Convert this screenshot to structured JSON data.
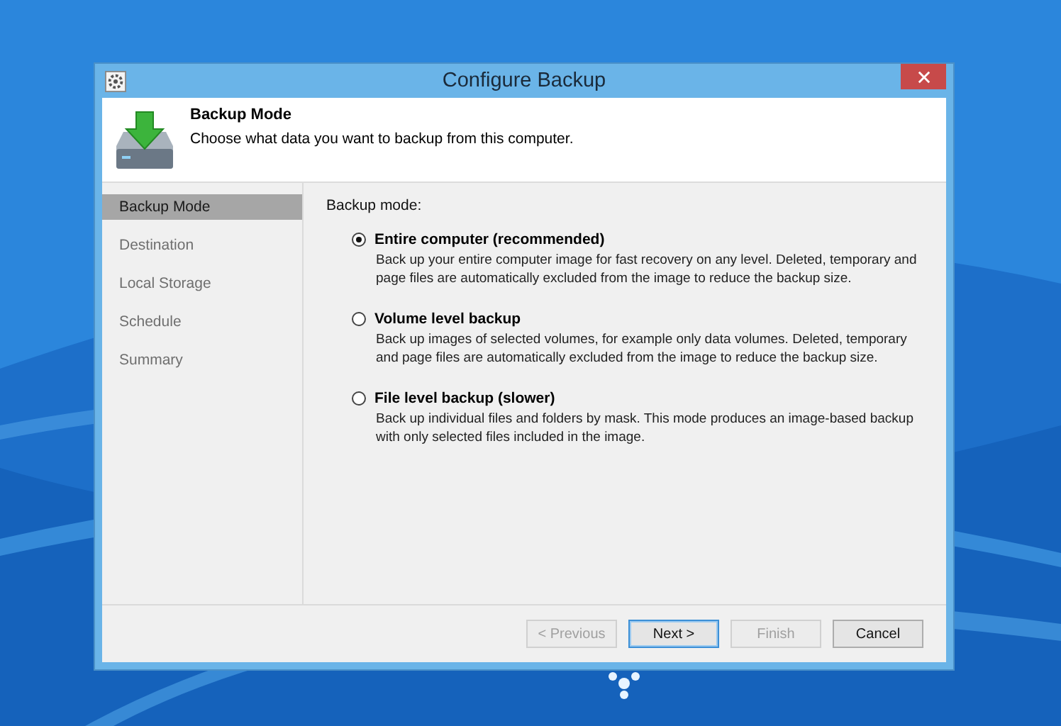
{
  "window": {
    "title": "Configure Backup"
  },
  "header": {
    "title": "Backup Mode",
    "subtitle": "Choose what data you want to backup from this computer."
  },
  "sidebar": {
    "items": [
      {
        "label": "Backup Mode",
        "selected": true
      },
      {
        "label": "Destination",
        "selected": false
      },
      {
        "label": "Local Storage",
        "selected": false
      },
      {
        "label": "Schedule",
        "selected": false
      },
      {
        "label": "Summary",
        "selected": false
      }
    ]
  },
  "content": {
    "label": "Backup mode:",
    "options": [
      {
        "label": "Entire computer (recommended)",
        "description": "Back up your entire computer image for fast recovery on any level. Deleted, temporary and page files are automatically excluded from the image to reduce the backup size.",
        "selected": true
      },
      {
        "label": "Volume level backup",
        "description": "Back up images of selected volumes, for example only data volumes. Deleted, temporary and page files are automatically excluded from the image to reduce the backup size.",
        "selected": false
      },
      {
        "label": "File level backup (slower)",
        "description": "Back up individual files and folders by mask. This mode produces an image-based backup with only selected files included in the image.",
        "selected": false
      }
    ]
  },
  "buttons": [
    {
      "label": "< Previous",
      "disabled": true,
      "default": false
    },
    {
      "label": "Next >",
      "disabled": false,
      "default": true
    },
    {
      "label": "Finish",
      "disabled": true,
      "default": false
    },
    {
      "label": "Cancel",
      "disabled": false,
      "default": false
    }
  ]
}
